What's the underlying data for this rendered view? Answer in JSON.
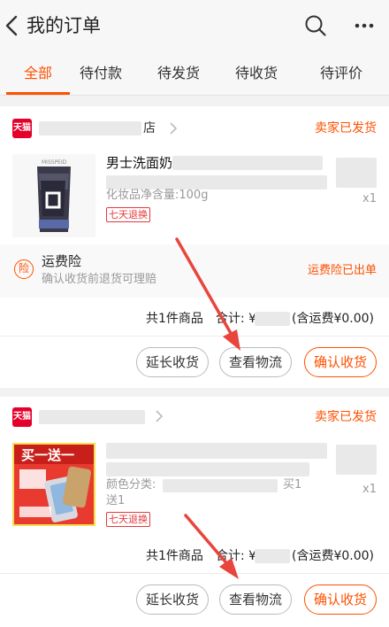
{
  "header": {
    "title": "我的订单"
  },
  "tabs": [
    "全部",
    "待付款",
    "待发货",
    "待收货",
    "待评价"
  ],
  "orders": [
    {
      "badge": "天猫",
      "store_suffix": "店",
      "status": "卖家已发货",
      "product_title": "男士洗面奶",
      "sku": "化妆品净含量:100g",
      "thumb_text": "MISSPEID",
      "tag": "七天退换",
      "qty": "x1",
      "insurance": {
        "icon": "险",
        "title": "运费险",
        "desc": "确认收货前退货可理赔",
        "status": "运费险已出单"
      },
      "summary": {
        "count": "共1件商品",
        "total_prefix": "合计: ¥",
        "shipping": "(含运费¥0.00)"
      },
      "buttons": [
        "延长收货",
        "查看物流",
        "确认收货"
      ]
    },
    {
      "badge": "天猫",
      "status": "卖家已发货",
      "sku_prefix": "颜色分类:",
      "sku_suffix": "买1",
      "sku_line2": "送1",
      "thumb_banner": "买一送一",
      "tag": "七天退换",
      "qty": "x1",
      "summary": {
        "count": "共1件商品",
        "total_prefix": "合计: ¥",
        "shipping": "(含运费¥0.00)"
      },
      "buttons": [
        "延长收货",
        "查看物流",
        "确认收货"
      ]
    }
  ]
}
